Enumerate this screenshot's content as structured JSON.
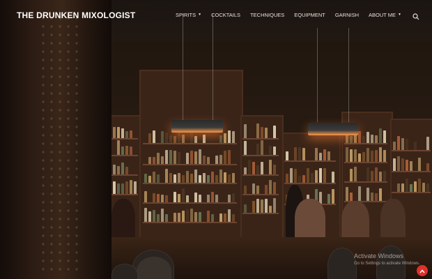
{
  "site": {
    "title": "THE DRUNKEN MIXOLOGIST"
  },
  "nav": {
    "items": [
      {
        "label": "SPIRITS",
        "has_dropdown": true
      },
      {
        "label": "COCKTAILS",
        "has_dropdown": false
      },
      {
        "label": "TECHNIQUES",
        "has_dropdown": false
      },
      {
        "label": "EQUIPMENT",
        "has_dropdown": false
      },
      {
        "label": "GARNISH",
        "has_dropdown": false
      },
      {
        "label": "ABOUT ME",
        "has_dropdown": true
      }
    ],
    "caret_glyph": "▼",
    "search_icon": "search-icon"
  },
  "os_overlay": {
    "title": "Activate Windows",
    "subtitle": "Go to Settings to activate Windows."
  },
  "scroll_top": {
    "icon": "chevron-up-icon",
    "color": "#e0302a"
  },
  "colors": {
    "nav_text": "#e8e0da",
    "title": "#ffffff",
    "accent": "#e0302a"
  }
}
